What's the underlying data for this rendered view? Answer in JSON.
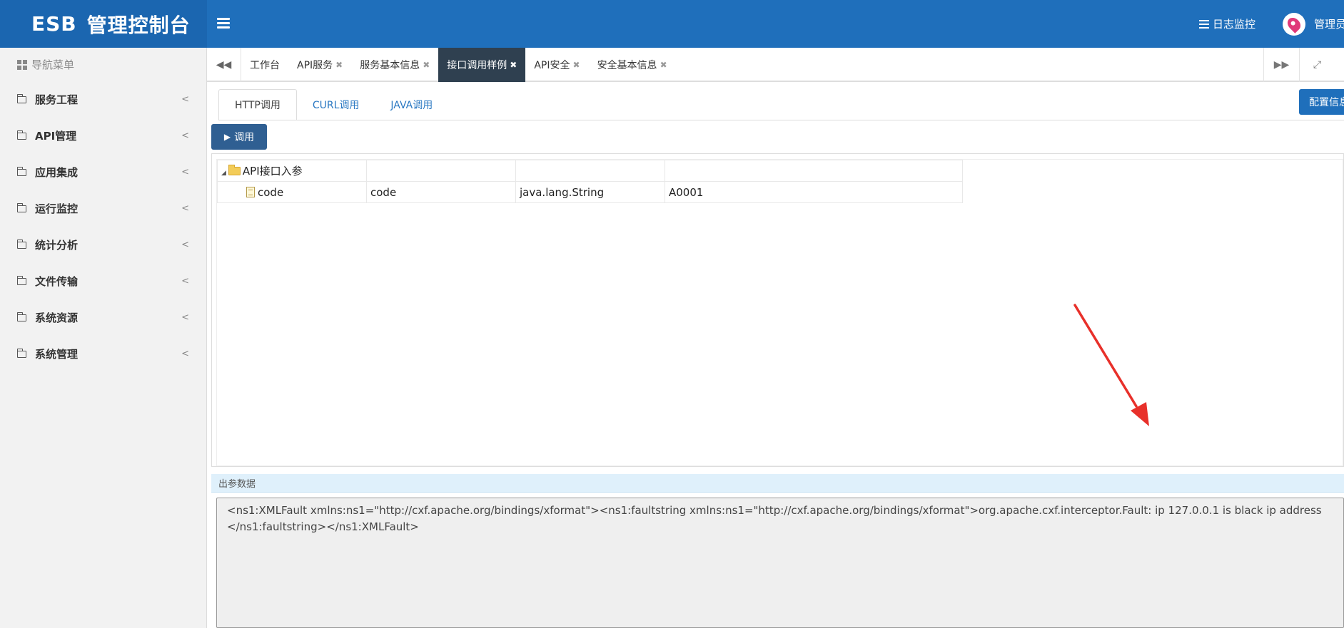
{
  "header": {
    "brand_esb": "ESB",
    "brand_title": "管理控制台",
    "log_monitor": "日志监控",
    "user": "管理员"
  },
  "sidebar": {
    "title": "导航菜单",
    "items": [
      {
        "label": "服务工程"
      },
      {
        "label": "API管理"
      },
      {
        "label": "应用集成"
      },
      {
        "label": "运行监控"
      },
      {
        "label": "统计分析"
      },
      {
        "label": "文件传输"
      },
      {
        "label": "系统资源"
      },
      {
        "label": "系统管理"
      }
    ]
  },
  "tabs": [
    {
      "label": "工作台",
      "closable": false
    },
    {
      "label": "API服务",
      "closable": true
    },
    {
      "label": "服务基本信息",
      "closable": true
    },
    {
      "label": "接口调用样例",
      "closable": true,
      "active": true
    },
    {
      "label": "API安全",
      "closable": true
    },
    {
      "label": "安全基本信息",
      "closable": true
    }
  ],
  "subtabs": [
    "HTTP调用",
    "CURL调用",
    "JAVA调用"
  ],
  "config_button": "配置信息",
  "invoke_button": "调用",
  "params": {
    "root": "API接口入参",
    "rows": [
      {
        "name": "code",
        "field": "code",
        "type": "java.lang.String",
        "value": "A0001"
      }
    ]
  },
  "output": {
    "title": "出参数据",
    "text": "<ns1:XMLFault xmlns:ns1=\"http://cxf.apache.org/bindings/xformat\"><ns1:faultstring xmlns:ns1=\"http://cxf.apache.org/bindings/xformat\">org.apache.cxf.interceptor.Fault: ip 127.0.0.1 is black ip address</ns1:faultstring></ns1:XMLFault>"
  },
  "colors": {
    "header_blue": "#1f6fbb",
    "active_tab": "#2f4050",
    "arrow_red": "#e8302a"
  }
}
